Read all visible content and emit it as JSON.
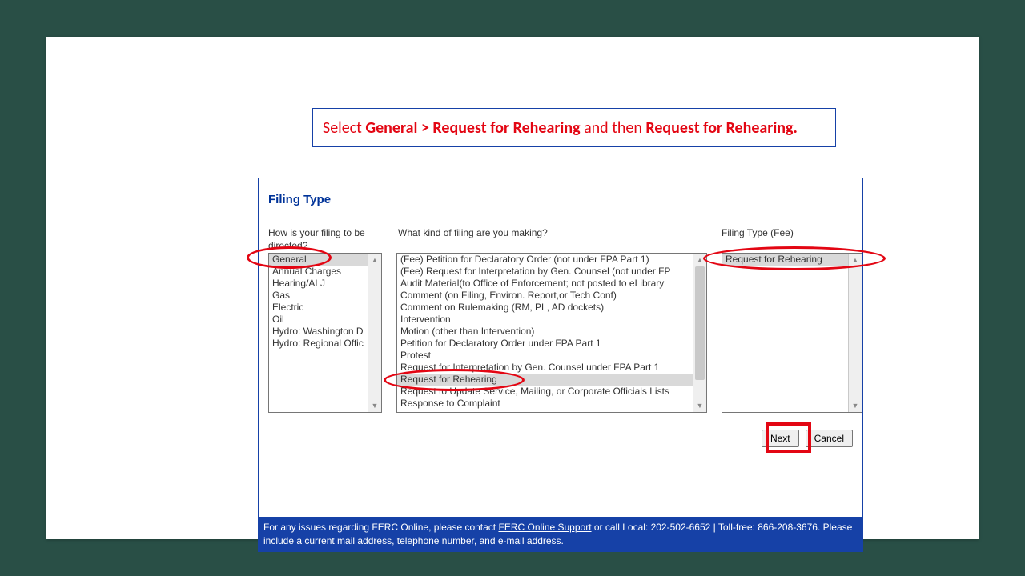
{
  "instruction": {
    "p1": "Select ",
    "b1": "General > Request for Rehearing",
    "p2": " and then ",
    "b2": "Request for Rehearing."
  },
  "panelTitle": "Filing Type",
  "columns": {
    "c1": "How is your filing to be directed?",
    "c2": "What kind of filing are you making?",
    "c3": "Filing Type (Fee)"
  },
  "list1": {
    "items": [
      "General",
      "Annual Charges",
      "Hearing/ALJ",
      "Gas",
      "Electric",
      "Oil",
      "Hydro: Washington D",
      "Hydro: Regional Offic"
    ],
    "selectedIndex": 0
  },
  "list2": {
    "items": [
      "(Fee) Petition for Declaratory Order (not under FPA Part 1)",
      "(Fee) Request for Interpretation by Gen. Counsel (not under FP",
      "Audit Material(to Office of Enforcement; not posted to eLibrary",
      "Comment (on Filing, Environ. Report,or Tech Conf)",
      "Comment on Rulemaking (RM, PL, AD dockets)",
      "Intervention",
      "Motion (other than Intervention)",
      "Petition for Declaratory Order under FPA Part 1",
      "Protest",
      "Request for Interpretation by Gen. Counsel under FPA Part 1",
      "Request for Rehearing",
      "Request to Update Service, Mailing, or Corporate Officials Lists",
      "Response to Complaint"
    ],
    "selectedIndex": 10
  },
  "list3": {
    "items": [
      "Request for Rehearing"
    ],
    "selectedIndex": 0
  },
  "buttons": {
    "next": "Next",
    "cancel": "Cancel"
  },
  "footer": {
    "t1": "For any issues regarding FERC Online, please contact ",
    "link": "FERC Online Support",
    "t2": " or call Local: 202-502-6652 | Toll-free: 866-208-3676. Please include a current mail address, telephone number, and e-mail address."
  }
}
